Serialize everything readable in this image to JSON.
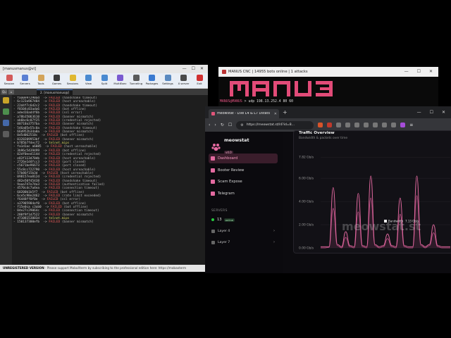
{
  "mobaxterm": {
    "title": "[manusmanus@vi]",
    "toolbar": [
      {
        "label": "Session",
        "icon": "session-icon",
        "color": "#d35a5a"
      },
      {
        "label": "Servers",
        "icon": "servers-icon",
        "color": "#5a7fd3"
      },
      {
        "label": "Tools",
        "icon": "tools-icon",
        "color": "#d3a45a"
      },
      {
        "label": "Games",
        "icon": "games-icon",
        "color": "#3a3a3a"
      },
      {
        "label": "Sessions",
        "icon": "sessions-icon",
        "color": "#e0b830"
      },
      {
        "label": "View",
        "icon": "view-icon",
        "color": "#4a8ad0"
      },
      {
        "label": "Split",
        "icon": "split-icon",
        "color": "#4a8ad0"
      },
      {
        "label": "MultiExec",
        "icon": "multiexec-icon",
        "color": "#7a5ad0"
      },
      {
        "label": "Tunneling",
        "icon": "tunneling-icon",
        "color": "#5a5a5a"
      },
      {
        "label": "Packages",
        "icon": "packages-icon",
        "color": "#3a7ad0"
      },
      {
        "label": "Settings",
        "icon": "settings-icon",
        "color": "#5a8ac0"
      },
      {
        "label": "X server",
        "icon": "xserver-icon",
        "color": "#4a4a4a"
      },
      {
        "label": "Exit",
        "icon": "exit-icon",
        "color": "#d03030"
      }
    ],
    "quick_connect": "Qu",
    "session_tab": "2. [manusmanus@]",
    "terminal_lines": [
      {
        "hash": "faa0e97290ad",
        "status": "FAILED",
        "reason": "(handshake timeout)"
      },
      {
        "hash": "6c123a967484",
        "status": "FAILED",
        "reason": "(host unreachable)"
      },
      {
        "hash": "22d4f7c6d2c2",
        "status": "FAILED",
        "reason": "(handshake timeout)"
      },
      {
        "hash": "f0104c03ada6",
        "status": "FAILED",
        "reason": "(bot offline)"
      },
      {
        "hash": "aded16ad4f6b",
        "status": "FAILED",
        "reason": "(ssl error)"
      },
      {
        "hash": "a78b35063610",
        "status": "FAILED",
        "reason": "(banner mismatch)"
      },
      {
        "hash": "ab6bc6c07f25",
        "status": "FAILED",
        "reason": "(credential rejected)"
      },
      {
        "hash": "00710a3757ba",
        "status": "FAILED",
        "reason": "(banner mismatch)"
      },
      {
        "hash": "546a05e55c0a",
        "status": "FAILED",
        "reason": "(handshake timeout)"
      },
      {
        "hash": "66d952b34a0a",
        "status": "FAILED",
        "reason": "(banner mismatch)"
      },
      {
        "hash": "0d5d062510c",
        "status": "FAILED",
        "reason": "(bot offline)"
      },
      {
        "hash": "0328209953bf",
        "status": "FAILED",
        "reason": "(banner mismatch)"
      },
      {
        "hash": "b785b7fdecf2",
        "status": "->",
        "reason": "telnet.mips",
        "ok": true
      },
      {
        "hash": "fa1d1ac a6085",
        "status": "FAILED",
        "reason": "(host unreachable)"
      },
      {
        "hash": "3b96c5439499",
        "status": "FAILED",
        "reason": "(bot offline)"
      },
      {
        "hash": "02df0eed114d",
        "status": "FAILED",
        "reason": "(credential rejected)"
      },
      {
        "hash": "e83f113d70db",
        "status": "FAILED",
        "reason": "(host unreachable)"
      },
      {
        "hash": "2726e1d4fcc3",
        "status": "FAILED",
        "reason": "(port closed)"
      },
      {
        "hash": "c5671be96673",
        "status": "FAILED",
        "reason": "(port closed)"
      },
      {
        "hash": "55c8cc722790",
        "status": "FAILED",
        "reason": "(host unreachable)"
      },
      {
        "hash": "57b86f15b3d",
        "status": "FAILED",
        "reason": "(host unreachable)"
      },
      {
        "hash": "098157ea812d",
        "status": "FAILED",
        "reason": "(credential rejected)"
      },
      {
        "hash": "482e50f45438",
        "status": "FAILED",
        "reason": "(handshake timeout)"
      },
      {
        "hash": "9aaa747e74a3",
        "status": "FAILED",
        "reason": "(authentication failed)"
      },
      {
        "hash": "4570cdc7a4ea",
        "status": "FAILED",
        "reason": "(connection timeout)"
      },
      {
        "hash": "60200b1b5f7",
        "status": "FAILED",
        "reason": "(bot offline)"
      },
      {
        "hash": "6ce5c98e2462",
        "status": "FAILED",
        "reason": "(rate limit exceeded)"
      },
      {
        "hash": "f6448ff0f0e",
        "status": "FAILED",
        "reason": "(ssl error)"
      },
      {
        "hash": "a37985984ef0",
        "status": "FAILED",
        "reason": "(bot offline)"
      },
      {
        "hash": "f15e0ca c3ab0",
        "status": "FAILED",
        "reason": "(bot offline)"
      },
      {
        "hash": "04e27c29064c",
        "status": "FAILED",
        "reason": "(connection timeout)"
      },
      {
        "hash": "280f9f1d7522",
        "status": "FAILED",
        "reason": "(banner mismatch)"
      },
      {
        "hash": "d7108153003d",
        "status": "->",
        "reason": "telnet.mips",
        "ok": true
      },
      {
        "hash": "150137300efb",
        "status": "FAILED",
        "reason": "(banner mismatch)"
      }
    ],
    "status_bar": {
      "edition": "UNREGISTERED VERSION",
      "message": "Please support MobaXterm by subscribing to the professional edition here:",
      "link": "https://mobaxterm"
    }
  },
  "cnc": {
    "title": "MANUS CNC | 14955 bots online | 1 attacks",
    "banner_text": "MANUS",
    "prompt_user": "MANUS@MANUS",
    "command": "> udp 198.13.252.4 80 60"
  },
  "browser": {
    "tab_title": "meowstat - Live L4 & L7 Dstats",
    "new_tab": "+",
    "address": "https://meowstat.st/l4?id=8...",
    "app": {
      "brand": "meowstat",
      "version": "v4.0",
      "nav": [
        {
          "label": "Dashboard",
          "active": true
        },
        {
          "label": "Booter Review",
          "active": false
        },
        {
          "label": "Scam Expose",
          "active": false
        },
        {
          "label": "Telegram",
          "active": false
        }
      ],
      "servers_header": "SERVERS",
      "online_count": "13",
      "online_label": "online",
      "layers": [
        "Layer 4",
        "Layer 7"
      ],
      "card_title": "Traffic Overview",
      "card_subtitle": "Bandwidth & packets over time",
      "watermark": "meowstat.st",
      "accent": "#e36aa0"
    }
  },
  "chart_data": {
    "type": "line",
    "title": "",
    "xlabel": "",
    "ylabel": "",
    "ylim": [
      0,
      8.5
    ],
    "y_ticks": [
      "0.00 Gb/s",
      "2.00 Gb/s",
      "4.00 Gb/s",
      "6.00 Gb/s",
      "7.82 Gb/s"
    ],
    "y_tick_values": [
      0,
      2,
      4,
      6,
      7.82
    ],
    "series": [
      {
        "name": "Bandwidth",
        "color": "#e36aa0",
        "values": [
          0.1,
          0.1,
          0.1,
          5.2,
          0.3,
          0.1,
          1.4,
          0.2,
          0.1,
          4.7,
          0.2,
          0.1,
          6.2,
          0.3,
          0.1,
          0.2,
          1.2,
          0.2,
          0.1,
          4.3,
          0.2,
          0.1,
          0.1,
          6.2,
          0.3,
          0.1,
          0.3,
          2.0,
          0.2,
          0.1,
          0.1,
          0.1
        ]
      },
      {
        "name": "",
        "color": "#b04a7c",
        "values": [
          0.0,
          0.0,
          0.05,
          3.4,
          0.2,
          0.0,
          0.9,
          0.1,
          0.0,
          3.1,
          0.1,
          0.0,
          4.3,
          0.2,
          0.0,
          0.1,
          0.8,
          0.1,
          0.0,
          2.9,
          0.1,
          0.0,
          0.0,
          4.5,
          0.2,
          0.0,
          0.2,
          1.3,
          0.1,
          0.0,
          0.0,
          0.0
        ]
      }
    ],
    "tooltip": {
      "label": "Bandwidth",
      "value": "7.13 Gb/s"
    }
  }
}
